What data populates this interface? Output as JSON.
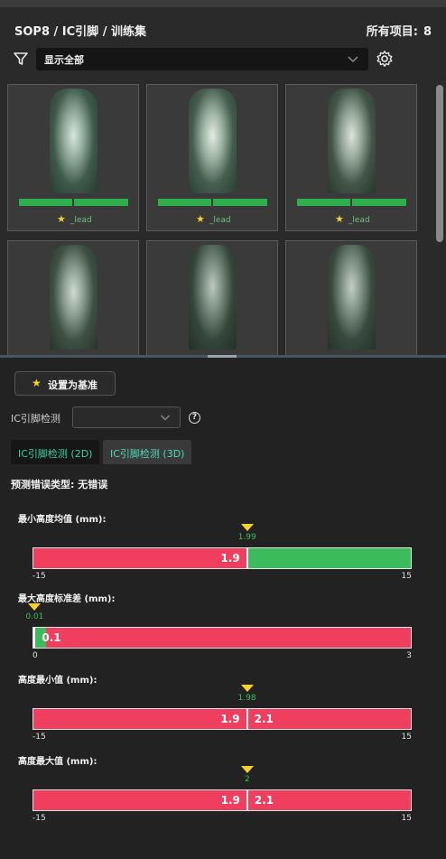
{
  "header": {
    "breadcrumb": "SOP8 / IC引脚 / 训练集",
    "count_label": "所有项目:",
    "count_value": "8"
  },
  "filter": {
    "icon": "filter-icon",
    "selected": "显示全部",
    "settings_icon": "gear-icon"
  },
  "gallery": {
    "items": [
      {
        "label": "_lead",
        "starred": true,
        "status": "pass"
      },
      {
        "label": "_lead",
        "starred": true,
        "status": "pass"
      },
      {
        "label": "_lead",
        "starred": true,
        "status": "pass"
      },
      {
        "label": "",
        "starred": false,
        "status": ""
      },
      {
        "label": "",
        "starred": false,
        "status": ""
      },
      {
        "label": "",
        "starred": false,
        "status": ""
      }
    ]
  },
  "panel": {
    "set_standard_label": "设置为基准",
    "detection_label": "IC引脚检测",
    "detection_value": "",
    "tabs": [
      {
        "label": "IC引脚检测 (2D)",
        "active": true
      },
      {
        "label": "IC引脚检测 (3D)",
        "active": false
      }
    ],
    "prediction_label": "预测错误类型: 无错误"
  },
  "metrics": [
    {
      "title": "最小高度均值 (mm):",
      "min": -15,
      "max": 15,
      "min_label": "-15",
      "max_label": "15",
      "threshold": 1.99,
      "threshold_label": "1.99",
      "value_label": "1.9",
      "upper_label": "",
      "green_from": 1.99,
      "green_to": 15
    },
    {
      "title": "最大高度标准差 (mm):",
      "min": 0,
      "max": 3,
      "min_label": "0",
      "max_label": "3",
      "threshold": 0.01,
      "threshold_label": "0.01",
      "value_label": "0.1",
      "upper_label": "",
      "green_from": 0,
      "green_to": 0.1
    },
    {
      "title": "高度最小值 (mm):",
      "min": -15,
      "max": 15,
      "min_label": "-15",
      "max_label": "15",
      "threshold": 1.98,
      "threshold_label": "1.98",
      "value_label": "1.9",
      "upper_label": "2.1",
      "green_from": 0,
      "green_to": 0
    },
    {
      "title": "高度最大值 (mm):",
      "min": -15,
      "max": 15,
      "min_label": "-15",
      "max_label": "15",
      "threshold": 2,
      "threshold_label": "2",
      "value_label": "1.9",
      "upper_label": "2.1",
      "green_from": 0,
      "green_to": 0
    }
  ],
  "colors": {
    "accent_green": "#3cbb5c",
    "fail_red": "#f03e5e",
    "star_yellow": "#f3d22a",
    "tab_teal": "#3ed0a0"
  }
}
